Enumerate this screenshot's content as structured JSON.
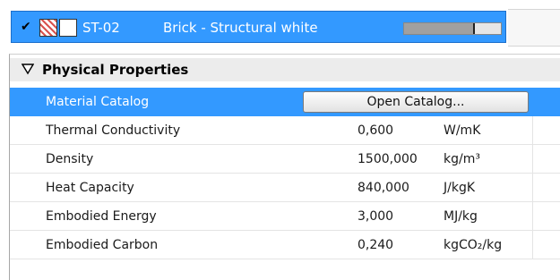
{
  "material": {
    "checked": true,
    "code": "ST-02",
    "name": "Brick - Structural white",
    "fill_fraction": 0.72
  },
  "section": {
    "title": "Physical Properties",
    "expanded": true
  },
  "properties": [
    {
      "label": "Material Catalog",
      "button": "Open Catalog...",
      "selected": true
    },
    {
      "label": "Thermal Conductivity",
      "value": "0,600",
      "unit": "W/mK"
    },
    {
      "label": "Density",
      "value": "1500,000",
      "unit": "kg/m³"
    },
    {
      "label": "Heat Capacity",
      "value": "840,000",
      "unit": "J/kgK"
    },
    {
      "label": "Embodied Energy",
      "value": "3,000",
      "unit": "MJ/kg"
    },
    {
      "label": "Embodied Carbon",
      "value": "0,240",
      "unit": "kgCO₂/kg"
    }
  ],
  "colors": {
    "selection": "#3399ff",
    "hatch": "#d9534f"
  },
  "icons": {
    "check": "checkmark-icon",
    "expand": "triangle-down-icon"
  }
}
